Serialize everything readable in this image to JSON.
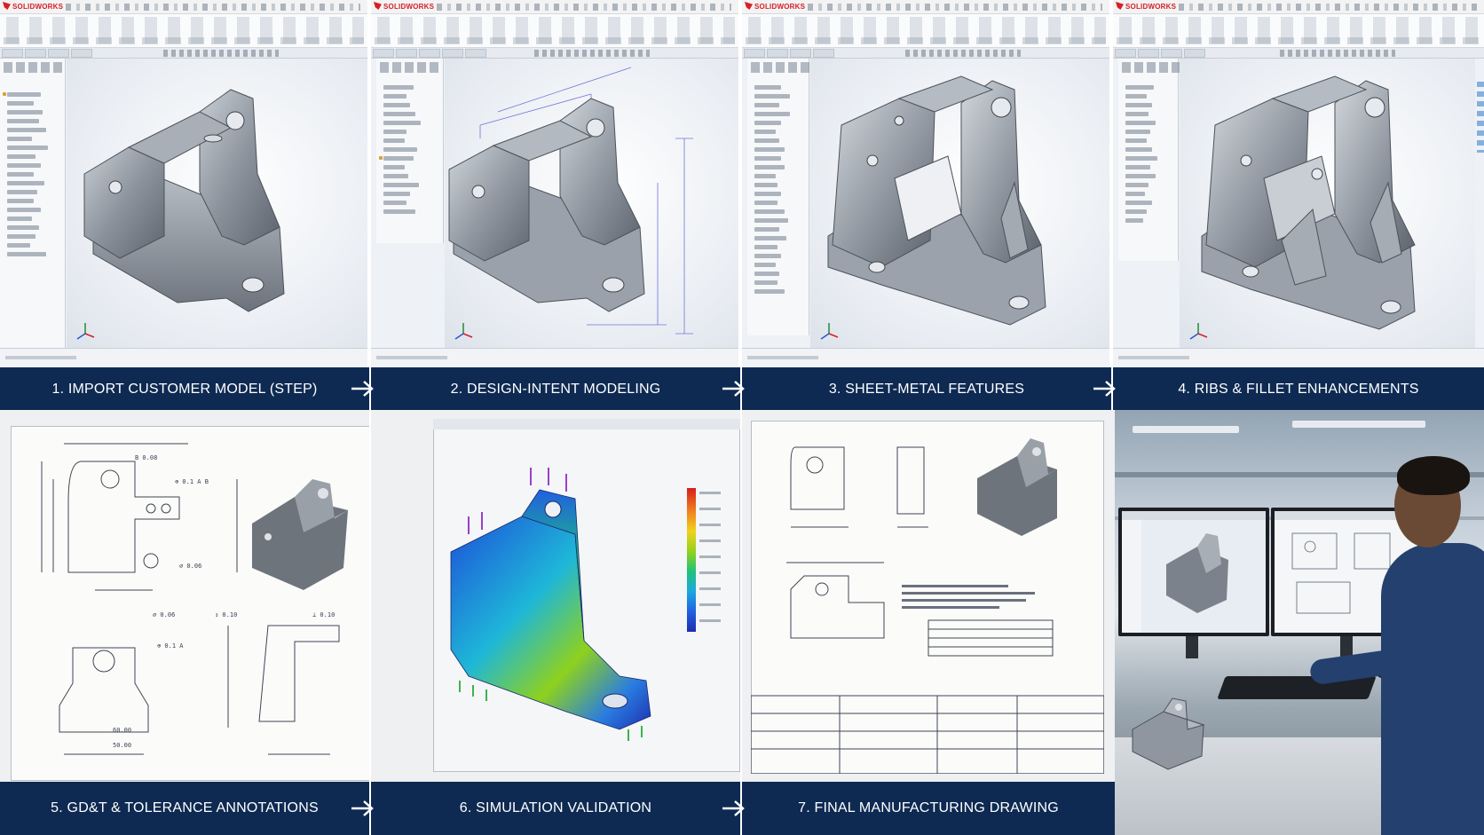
{
  "app": {
    "logo_text": "SOLIDWORKS"
  },
  "steps": [
    {
      "label": "1. IMPORT CUSTOMER MODEL (STEP)"
    },
    {
      "label": "2. DESIGN-INTENT MODELING"
    },
    {
      "label": "3. SHEET-METAL FEATURES"
    },
    {
      "label": "4. RIBS & FILLET ENHANCEMENTS"
    },
    {
      "label": "5. GD&T & TOLERANCE ANNOTATIONS"
    },
    {
      "label": "6. SIMULATION VALIDATION"
    },
    {
      "label": "7. FINAL MANUFACTURING DRAWING"
    }
  ],
  "colors": {
    "caption_bg": "#0e2a52",
    "caption_text": "#ffffff",
    "brand_red": "#d62027",
    "part_metal": "#8e959e"
  },
  "icons": [
    "arrow-right-icon",
    "triad-icon",
    "solidworks-logo-icon"
  ]
}
